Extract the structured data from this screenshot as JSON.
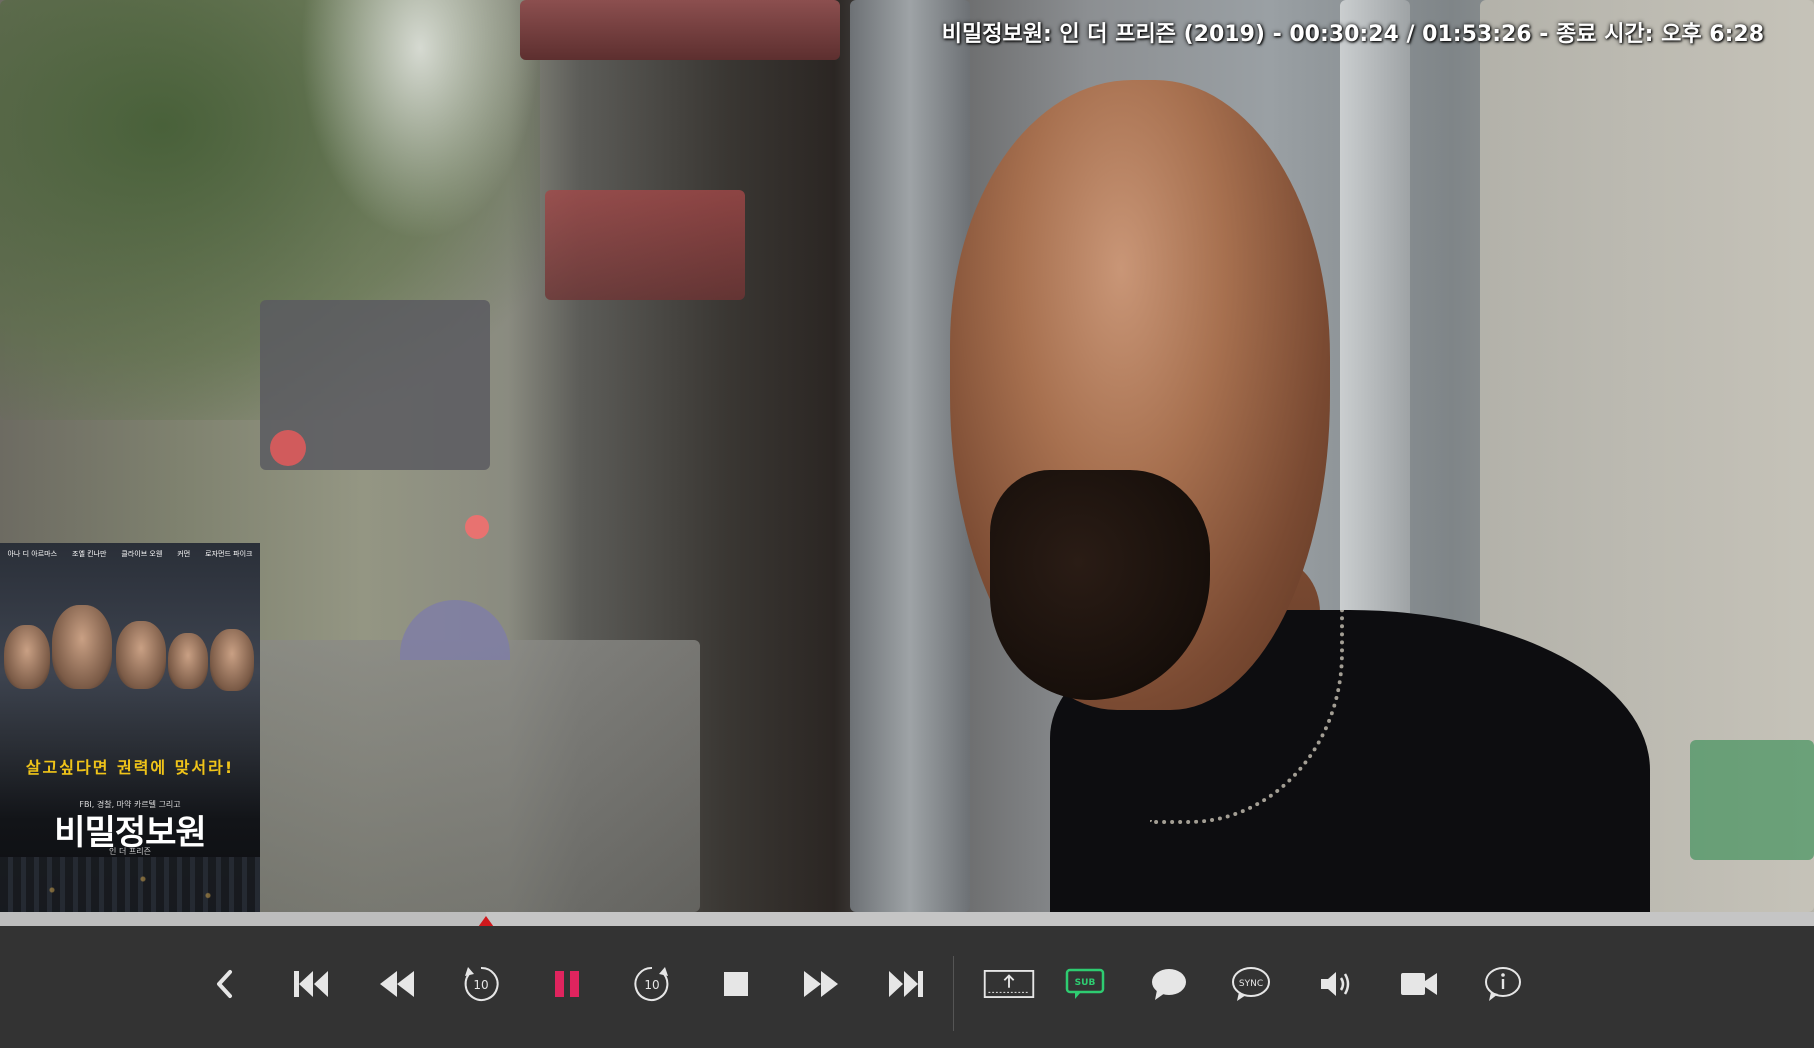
{
  "player": {
    "title_bar": "비밀정보원: 인 더 프리즌 (2019) - 00:30:24 / 01:53:26 - 종료 시간: 오후 6:28",
    "movie_title": "비밀정보원: 인 더 프리즌",
    "year": "2019",
    "elapsed": "00:30:24",
    "duration": "01:53:26",
    "end_time_label": "종료 시간: 오후 6:28",
    "progress_fraction": 0.268,
    "state": "paused"
  },
  "poster": {
    "credits": [
      "아나 디 아르마스",
      "조엘 킨나만",
      "클라이브 오웬",
      "커먼",
      "로자먼드 파이크"
    ],
    "tagline": "살고싶다면 권력에 맞서라!",
    "subtitle": "FBI, 경찰, 마약 카르텔 그리고",
    "title": "비밀정보원",
    "title_sub": "인 더 프리즌"
  },
  "controls": [
    {
      "name": "back-button",
      "icon": "chevron-left-icon"
    },
    {
      "name": "previous-button",
      "icon": "skip-previous-icon"
    },
    {
      "name": "rewind-button",
      "icon": "rewind-icon"
    },
    {
      "name": "replay-10-button",
      "icon": "replay-10-icon",
      "label": "10"
    },
    {
      "name": "pause-button",
      "icon": "pause-icon"
    },
    {
      "name": "forward-10-button",
      "icon": "forward-10-icon",
      "label": "10"
    },
    {
      "name": "stop-button",
      "icon": "stop-icon"
    },
    {
      "name": "fast-forward-button",
      "icon": "fast-forward-icon"
    },
    {
      "name": "next-button",
      "icon": "skip-next-icon"
    },
    {
      "name": "aspect-button",
      "icon": "aspect-ratio-icon"
    },
    {
      "name": "subtitles-button",
      "icon": "subtitles-icon",
      "label": "SUB"
    },
    {
      "name": "chat-button",
      "icon": "speech-bubble-icon"
    },
    {
      "name": "sync-button",
      "icon": "sync-icon",
      "label": "SYNC"
    },
    {
      "name": "volume-button",
      "icon": "volume-icon"
    },
    {
      "name": "video-settings-button",
      "icon": "video-camera-icon"
    },
    {
      "name": "info-button",
      "icon": "info-icon"
    }
  ],
  "colors": {
    "accent": "#e0245e",
    "marker": "#d0181c",
    "subtitle_active": "#2ecc71",
    "icon": "#e6e6e6",
    "bar": "#333333"
  }
}
